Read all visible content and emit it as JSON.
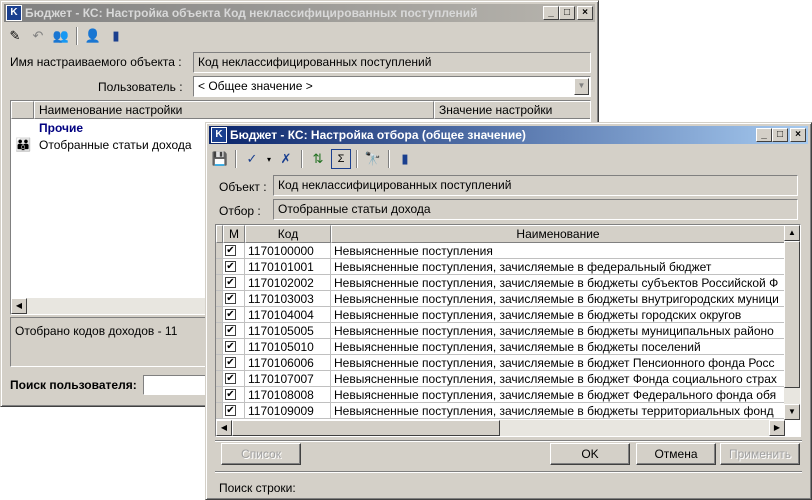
{
  "back_window": {
    "title": "Бюджет - КС: Настройка объекта Код неклассифицированных поступлений",
    "object_label": "Имя настраиваемого объекта :",
    "object_value": "Код неклассифицированных поступлений",
    "user_label": "Пользователь :",
    "user_value": "< Общее значение >",
    "columns": [
      "Наименование настройки",
      "Значение настройки"
    ],
    "tree": [
      {
        "label": "Прочие",
        "bold": true
      },
      {
        "label": "Отобранные статьи дохода",
        "bold": false
      }
    ],
    "info_text": "Отобрано кодов доходов - 11",
    "search_label": "Поиск пользователя:"
  },
  "front_window": {
    "title": "Бюджет - КС: Настройка отбора (общее значение)",
    "object_label": "Объект :",
    "object_value": "Код неклассифицированных поступлений",
    "filter_label": "Отбор :",
    "filter_value": "Отобранные статьи дохода",
    "columns": {
      "mark": "М",
      "code": "Код",
      "name": "Наименование"
    },
    "rows": [
      {
        "code": "1170100000",
        "name": "Невыясненные поступления"
      },
      {
        "code": "1170101001",
        "name": "Невыясненные поступления, зачисляемые в федеральный бюджет"
      },
      {
        "code": "1170102002",
        "name": "Невыясненные поступления, зачисляемые в бюджеты субъектов Российской Ф"
      },
      {
        "code": "1170103003",
        "name": "Невыясненные поступления, зачисляемые в бюджеты внутригородских муници"
      },
      {
        "code": "1170104004",
        "name": "Невыясненные поступления, зачисляемые в бюджеты городских округов"
      },
      {
        "code": "1170105005",
        "name": "Невыясненные поступления, зачисляемые в бюджеты муниципальных районо"
      },
      {
        "code": "1170105010",
        "name": "Невыясненные поступления, зачисляемые в бюджеты поселений"
      },
      {
        "code": "1170106006",
        "name": "Невыясненные поступления, зачисляемые в бюджет Пенсионного фонда Росс"
      },
      {
        "code": "1170107007",
        "name": "Невыясненные поступления, зачисляемые в бюджет Фонда социального страх"
      },
      {
        "code": "1170108008",
        "name": "Невыясненные поступления, зачисляемые в бюджет Федерального фонда обя"
      },
      {
        "code": "1170109009",
        "name": "Невыясненные поступления, зачисляемые в бюджеты территориальных фонд"
      }
    ],
    "buttons": {
      "list": "Список",
      "ok": "OK",
      "cancel": "Отмена",
      "apply": "Применить"
    },
    "search_label": "Поиск строки:"
  },
  "icons": {
    "app": "kc-app-icon",
    "check": "✔"
  }
}
